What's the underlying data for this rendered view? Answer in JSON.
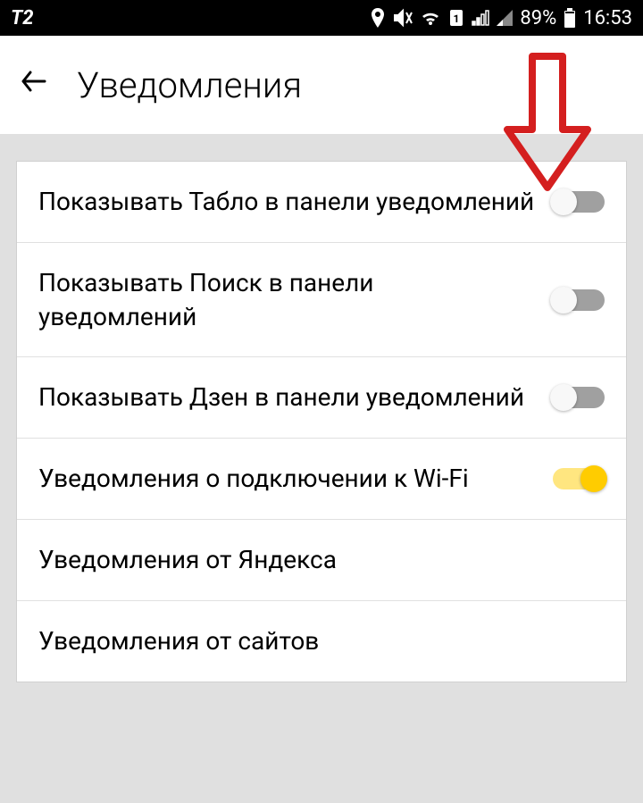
{
  "status_bar": {
    "carrier": "T2",
    "battery_pct": "89%",
    "time": "16:53"
  },
  "header": {
    "title": "Уведомления"
  },
  "settings": [
    {
      "label": "Показывать Табло в панели уведомлений",
      "toggle": "off"
    },
    {
      "label": "Показывать Поиск в панели уведомлений",
      "toggle": "off"
    },
    {
      "label": "Показывать Дзен в панели уведомлений",
      "toggle": "off"
    },
    {
      "label": "Уведомления о подключении к Wi-Fi",
      "toggle": "on"
    },
    {
      "label": "Уведомления от Яндекса",
      "toggle": null
    },
    {
      "label": "Уведомления от сайтов",
      "toggle": null
    }
  ],
  "annotation": {
    "arrow_color": "#d41f1f"
  }
}
